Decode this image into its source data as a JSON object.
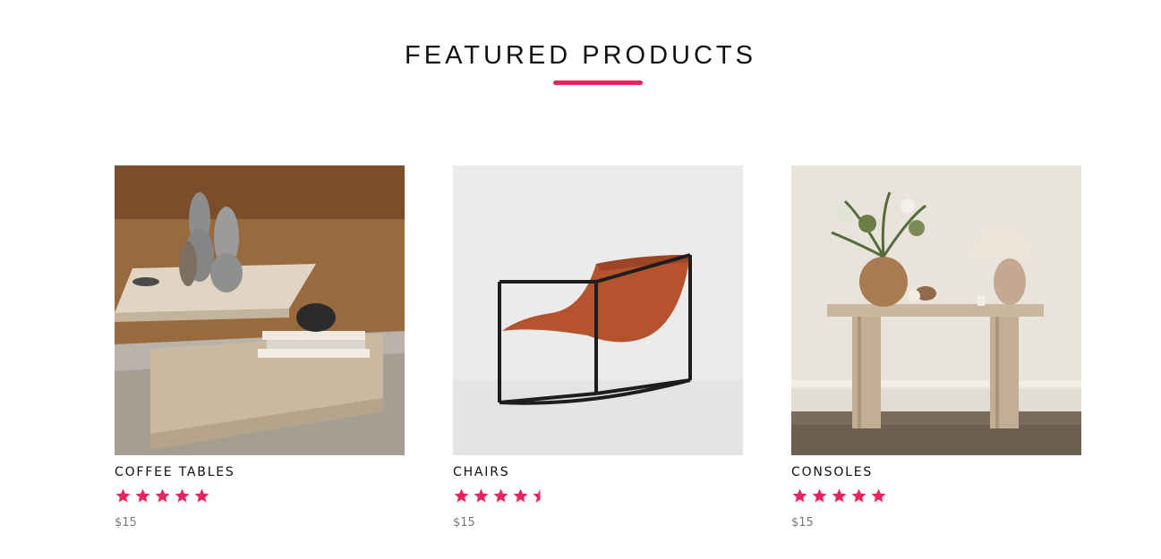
{
  "section": {
    "title": "FEATURED PRODUCTS",
    "accent_color": "#e8245a"
  },
  "products": [
    {
      "name": "COFFEE TABLES",
      "rating": 5,
      "rating_max": 5,
      "price": "$15",
      "image": "coffee-table-photo"
    },
    {
      "name": "CHAIRS",
      "rating": 4.5,
      "rating_max": 5,
      "price": "$15",
      "image": "chair-photo"
    },
    {
      "name": "CONSOLES",
      "rating": 5,
      "rating_max": 5,
      "price": "$15",
      "image": "console-table-photo"
    }
  ],
  "icons": {
    "star": "star-icon"
  }
}
